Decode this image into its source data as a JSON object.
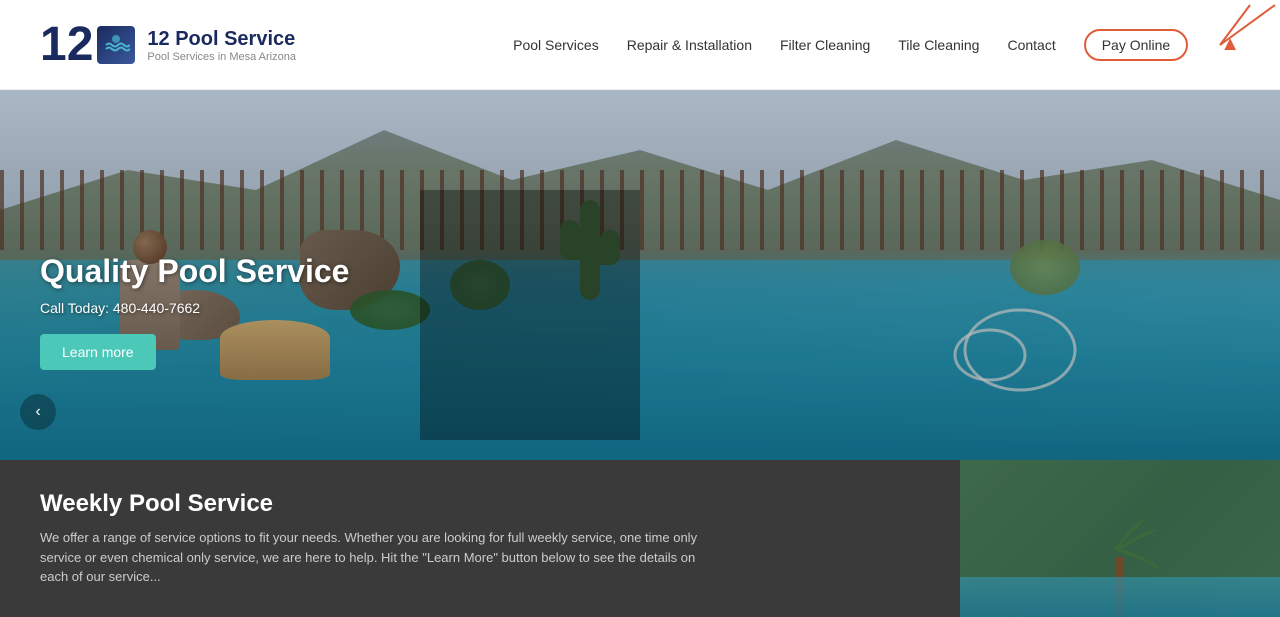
{
  "header": {
    "logo_number": "12",
    "brand_name": "12 Pool Service",
    "brand_sub": "Pool Services in Mesa Arizona",
    "nav": {
      "items": [
        {
          "label": "Pool Services",
          "href": "#"
        },
        {
          "label": "Repair & Installation",
          "href": "#"
        },
        {
          "label": "Filter Cleaning",
          "href": "#"
        },
        {
          "label": "Tile Cleaning",
          "href": "#"
        },
        {
          "label": "Contact",
          "href": "#"
        }
      ],
      "pay_online": "Pay Online"
    }
  },
  "hero": {
    "title": "Quality Pool Service",
    "phone_label": "Call Today: 480-440-7662",
    "learn_more": "Learn more",
    "arrow": "‹"
  },
  "bottom": {
    "title": "Weekly Pool Service",
    "text": "We offer a range of service options to fit your needs. Whether you are looking for full weekly service, one time only service or even chemical only service, we are here to help. Hit the \"Learn More\" button below to see the details on each of our service..."
  },
  "annotations": {
    "tile_cleaning_arrow_color": "#e05c3a",
    "circle_color": "#e05c3a"
  }
}
